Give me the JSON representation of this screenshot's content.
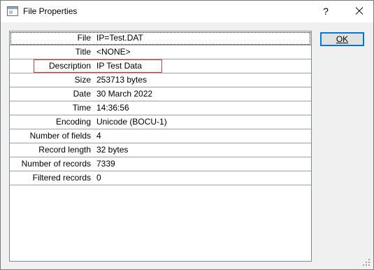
{
  "window": {
    "title": "File Properties",
    "help_label": "?",
    "app_icon": "window-icon",
    "close_icon": "close-icon"
  },
  "properties": [
    {
      "label": "File",
      "value": "IP=Test.DAT"
    },
    {
      "label": "Title",
      "value": "<NONE>"
    },
    {
      "label": "Description",
      "value": "IP Test Data"
    },
    {
      "label": "Size",
      "value": "253713 bytes"
    },
    {
      "label": "Date",
      "value": "30 March 2022"
    },
    {
      "label": "Time",
      "value": "14:36:56"
    },
    {
      "label": "Encoding",
      "value": "Unicode (BOCU-1)"
    },
    {
      "label": "Number of fields",
      "value": "4"
    },
    {
      "label": "Record length",
      "value": "32 bytes"
    },
    {
      "label": "Number of records",
      "value": "7339"
    },
    {
      "label": "Filtered records",
      "value": "0"
    }
  ],
  "buttons": {
    "ok_label": "OK"
  },
  "colors": {
    "highlight_border": "#d04040",
    "default_button_border": "#0078d7"
  }
}
